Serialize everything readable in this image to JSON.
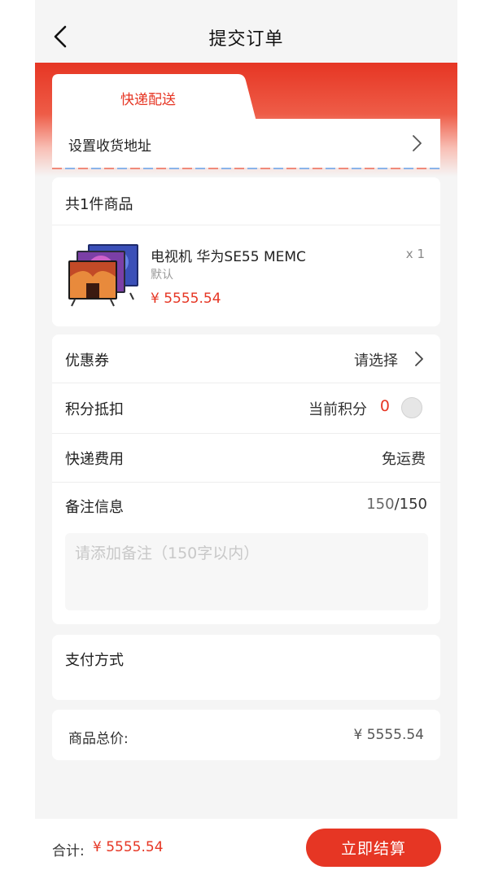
{
  "header": {
    "title": "提交订单",
    "back_icon": "chevron-left-icon"
  },
  "delivery": {
    "tab_label": "快递配送",
    "address_prompt": "设置收货地址",
    "chevron_icon": "chevron-right-icon"
  },
  "goods": {
    "count_label": "共1件商品",
    "items": [
      {
        "name": "电视机 华为SE55 MEMC",
        "spec": "默认",
        "price": "¥ 5555.54",
        "qty": "x 1",
        "image_icon": "tv-product-image"
      }
    ]
  },
  "options": {
    "coupon": {
      "label": "优惠券",
      "value": "请选择"
    },
    "points": {
      "label": "积分抵扣",
      "current_label": "当前积分",
      "current_value": "0"
    },
    "shipping": {
      "label": "快递费用",
      "value": "免运费"
    },
    "note": {
      "label": "备注信息",
      "count_used": "150",
      "count_sep": "/",
      "count_max": "150",
      "placeholder": "请添加备注（150字以内）"
    }
  },
  "payment": {
    "label": "支付方式"
  },
  "summary": {
    "label": "商品总价:",
    "value": "¥ 5555.54"
  },
  "footer": {
    "sum_label": "合计:",
    "sum_value": "¥ 5555.54",
    "checkout_label": "立即结算"
  },
  "colors": {
    "accent": "#e63624",
    "background": "#f5f5f5",
    "card": "#ffffff"
  }
}
